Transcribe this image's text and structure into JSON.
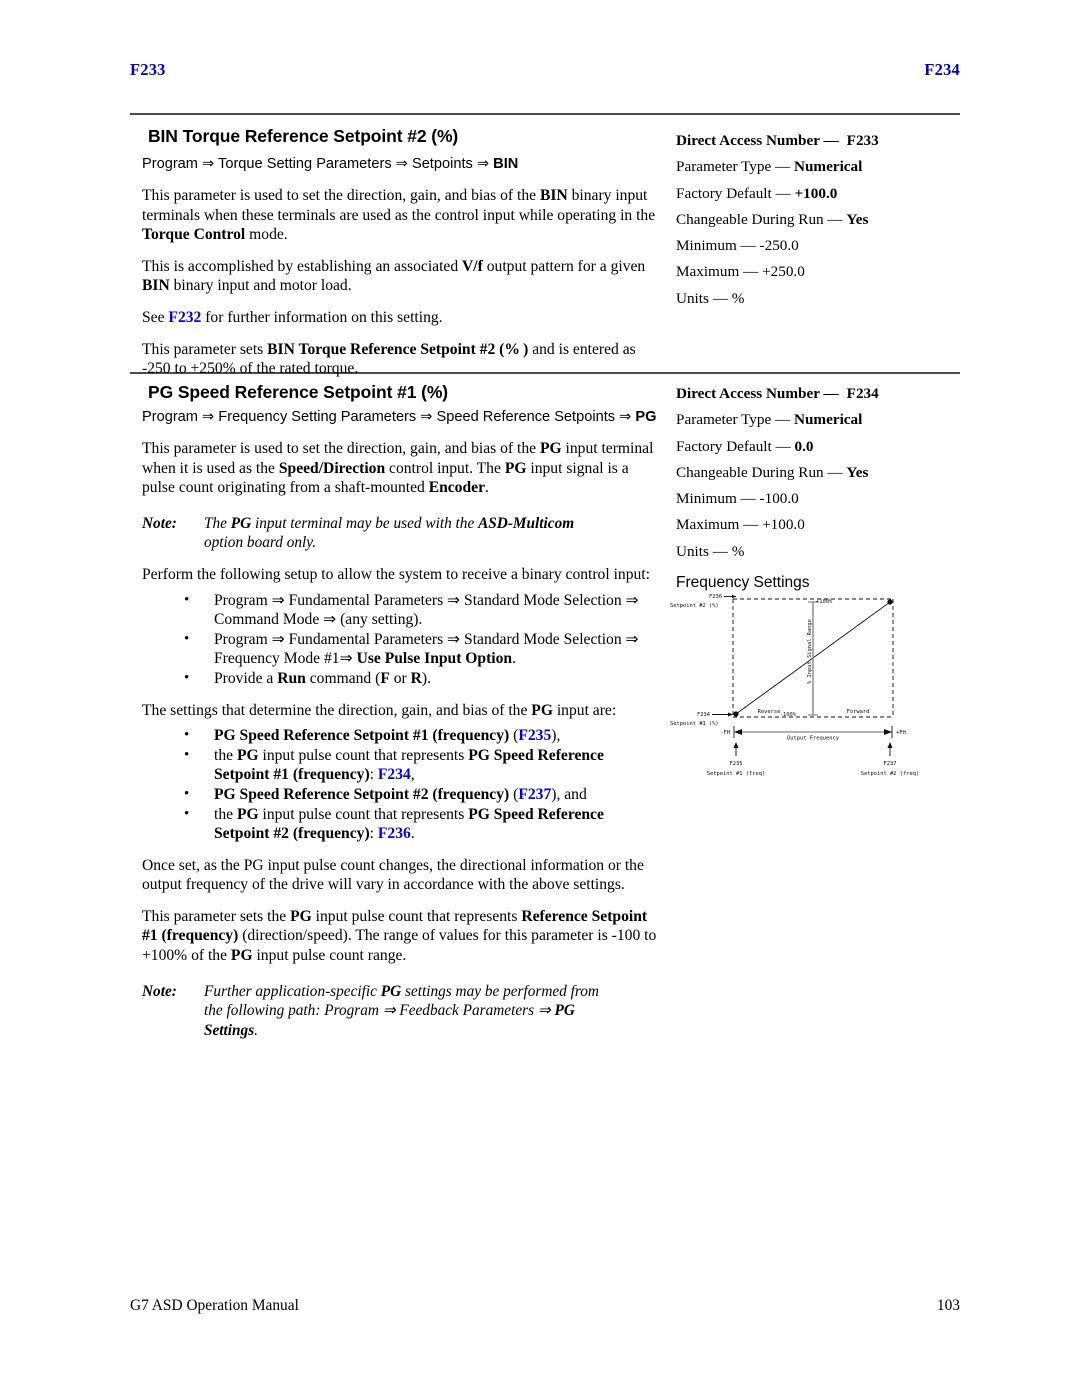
{
  "runhead": {
    "left": "F233",
    "right": "F234"
  },
  "sections": [
    {
      "title": "BIN Torque Reference Setpoint #2 (%)",
      "path_prefix": "Program ⇒ Torque Setting Parameters ⇒ Setpoints ⇒ ",
      "path_bold": "BIN",
      "paragraphs": [
        "This parameter is used to set the direction, gain, and bias of the BIN binary input terminals when these terminals are used as the control input while operating in the Torque Control mode.",
        "This is accomplished by establishing an associated V/f output pattern for a given BIN binary input and motor load.",
        "See F232 for further information on this setting.",
        "This parameter sets BIN Torque Reference Setpoint #2 (%) and is entered as -250 to +250% of the rated torque."
      ],
      "spec": {
        "direct_access_label": "Direct Access Number —",
        "direct_access_value": "F233",
        "type_label": "Parameter Type — ",
        "type_value": "Numerical",
        "default_label": "Factory Default — ",
        "default_value": "+100.0",
        "run_label": "Changeable During Run — ",
        "run_value": "Yes",
        "min_label": "Minimum — ",
        "min_value": "-250.0",
        "max_label": "Maximum — ",
        "max_value": "+250.0",
        "units_label": "Units — ",
        "units_value": "%"
      }
    },
    {
      "title": "PG Speed Reference Setpoint #1 (%)",
      "path_prefix": "Program ⇒ Frequency Setting Parameters ⇒ Speed Reference Setpoints ⇒ ",
      "path_bold": "PG",
      "para1": "This parameter is used to set the direction, gain, and bias of the PG input terminal when it is used as the Speed/Direction control input. The PG input signal is a pulse count originating from a shaft-mounted Encoder.",
      "note1_label": "Note:",
      "note1_text": "The PG input terminal may be used with the ASD-Multicom option board only.",
      "para2": "Perform the following setup to allow the system to receive a binary control input:",
      "bullets1": [
        "Program ⇒ Fundamental Parameters ⇒ Standard Mode Selection ⇒ Command Mode ⇒ (any setting).",
        "Program ⇒ Fundamental Parameters ⇒ Standard Mode Selection ⇒ Frequency Mode #1⇒ Use Pulse Input Option.",
        "Provide a Run command (F or R)."
      ],
      "para3": "The settings that determine the direction, gain, and bias of the PG input are:",
      "bullets2": [
        "PG Speed Reference Setpoint #1 (frequency) (F235),",
        "the PG input pulse count that represents PG Speed Reference Setpoint #1 (frequency): F234,",
        "PG Speed Reference Setpoint #2 (frequency) (F237), and",
        "the PG input pulse count that represents PG Speed Reference Setpoint #2 (frequency): F236."
      ],
      "para4": "Once set, as the PG input pulse count changes, the directional information or the output frequency of the drive will vary in accordance with the above settings.",
      "para5": "This parameter sets the PG input pulse count that represents Reference Setpoint #1 (frequency) (direction/speed). The range of values for this parameter is -100 to +100% of the PG input pulse count range.",
      "note2_label": "Note:",
      "note2_text": "Further application-specific PG settings may be performed from the following path: Program ⇒ Feedback Parameters ⇒ PG Settings.",
      "spec": {
        "direct_access_label": "Direct Access Number —",
        "direct_access_value": "F234",
        "type_label": "Parameter Type — ",
        "type_value": "Numerical",
        "default_label": "Factory Default — ",
        "default_value": "0.0",
        "run_label": "Changeable During Run — ",
        "run_value": "Yes",
        "min_label": "Minimum — ",
        "min_value": "-100.0",
        "max_label": "Maximum — ",
        "max_value": "+100.0",
        "units_label": "Units — ",
        "units_value": "%",
        "frequency_settings": "Frequency Settings"
      }
    }
  ],
  "diagram": {
    "top_left_param": "F236",
    "top_left_sub": "Setpoint #2 (%)",
    "bottom_left_param": "F234",
    "bottom_left_sub": "Setpoint #1 (%)",
    "y_axis_label": "% Input Signal Range",
    "y_top": "+100%",
    "y_bottom": "-100%",
    "reverse": "Reverse",
    "forward": "Forward",
    "x_axis_label": "Output Frequency",
    "x_left": "-FH",
    "x_right": "+FH",
    "bottom_left_freq_param": "F235",
    "bottom_left_freq_sub": "Setpoint #1 (freq)",
    "bottom_right_freq_param": "F237",
    "bottom_right_freq_sub": "Setpoint #2 (freq)"
  },
  "footer": {
    "left": "G7 ASD Operation Manual",
    "right": "103"
  }
}
